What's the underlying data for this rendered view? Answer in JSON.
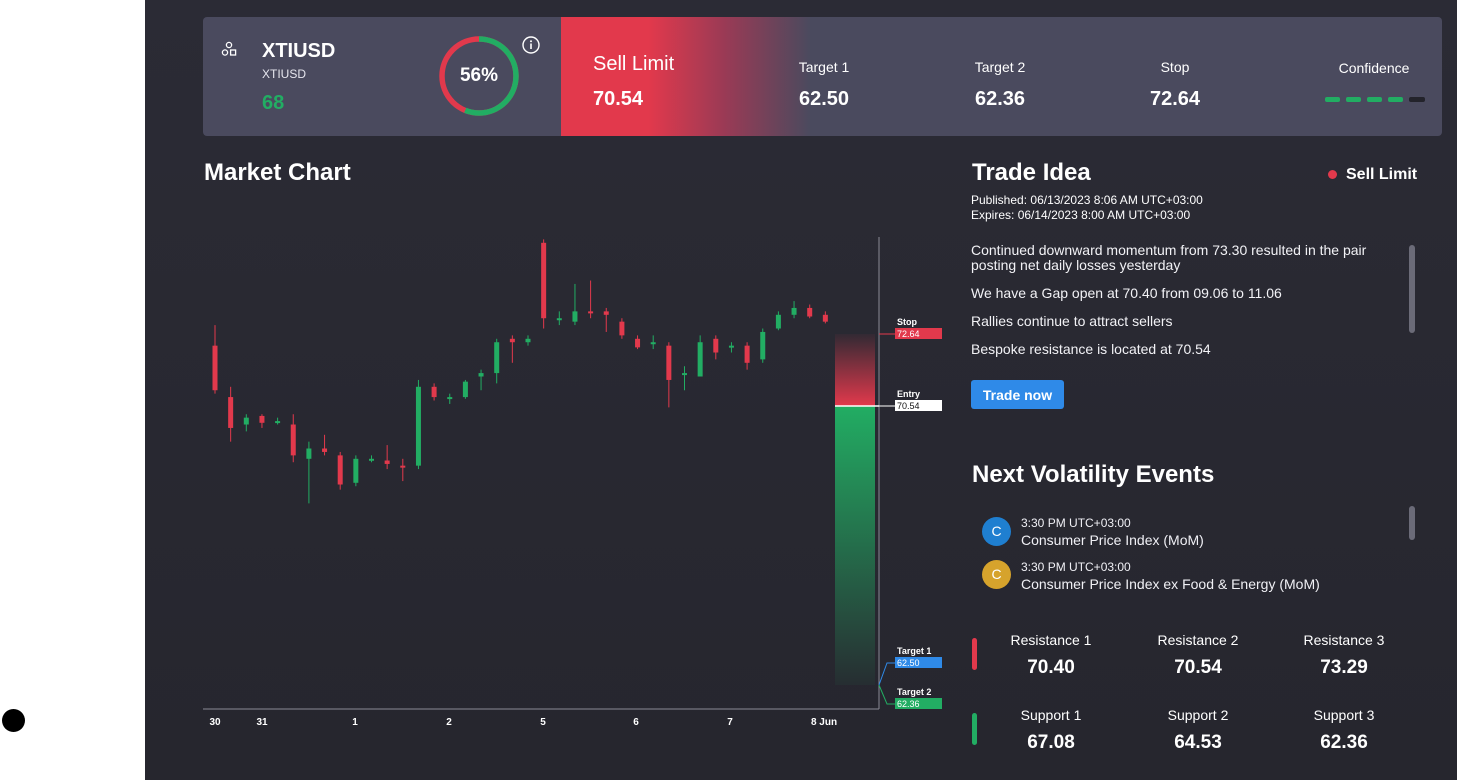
{
  "instrument": {
    "symbol": "XTIUSD",
    "sub_symbol": "XTIUSD",
    "score": "68",
    "percent": "56%",
    "percent_value": 56
  },
  "signal": {
    "label": "Sell Limit",
    "price": "70.54"
  },
  "metrics": [
    {
      "label": "Target 1",
      "value": "62.50"
    },
    {
      "label": "Target 2",
      "value": "62.36"
    },
    {
      "label": "Stop",
      "value": "72.64"
    }
  ],
  "confidence": {
    "label": "Confidence",
    "level": 4,
    "max": 5
  },
  "market_chart": {
    "title": "Market Chart"
  },
  "chart_data": {
    "type": "candlestick",
    "x_tick_labels": [
      "30",
      "31",
      "1",
      "2",
      "5",
      "6",
      "7",
      "8 Jun"
    ],
    "candles": [
      {
        "o": 72.3,
        "h": 72.9,
        "l": 70.9,
        "c": 71.0
      },
      {
        "o": 70.8,
        "h": 71.1,
        "l": 69.5,
        "c": 69.9
      },
      {
        "o": 70.0,
        "h": 70.3,
        "l": 69.8,
        "c": 70.2
      },
      {
        "o": 70.25,
        "h": 70.3,
        "l": 69.9,
        "c": 70.05
      },
      {
        "o": 70.1,
        "h": 70.2,
        "l": 70.0,
        "c": 70.1
      },
      {
        "o": 70.0,
        "h": 70.3,
        "l": 68.9,
        "c": 69.1
      },
      {
        "o": 69.0,
        "h": 69.5,
        "l": 67.7,
        "c": 69.3
      },
      {
        "o": 69.3,
        "h": 69.7,
        "l": 69.1,
        "c": 69.2
      },
      {
        "o": 69.1,
        "h": 69.2,
        "l": 68.1,
        "c": 68.25
      },
      {
        "o": 68.3,
        "h": 69.1,
        "l": 68.2,
        "c": 69.0
      },
      {
        "o": 69.0,
        "h": 69.1,
        "l": 68.9,
        "c": 69.0
      },
      {
        "o": 68.95,
        "h": 69.4,
        "l": 68.7,
        "c": 68.85
      },
      {
        "o": 68.8,
        "h": 69.0,
        "l": 68.35,
        "c": 68.75
      },
      {
        "o": 68.8,
        "h": 71.3,
        "l": 68.7,
        "c": 71.1
      },
      {
        "o": 71.1,
        "h": 71.2,
        "l": 70.7,
        "c": 70.8
      },
      {
        "o": 70.8,
        "h": 70.9,
        "l": 70.6,
        "c": 70.8
      },
      {
        "o": 70.8,
        "h": 71.3,
        "l": 70.75,
        "c": 71.25
      },
      {
        "o": 71.4,
        "h": 71.6,
        "l": 71.0,
        "c": 71.5
      },
      {
        "o": 71.5,
        "h": 72.5,
        "l": 71.2,
        "c": 72.4
      },
      {
        "o": 72.5,
        "h": 72.6,
        "l": 71.8,
        "c": 72.4
      },
      {
        "o": 72.4,
        "h": 72.6,
        "l": 72.3,
        "c": 72.5
      },
      {
        "o": 75.3,
        "h": 75.4,
        "l": 72.8,
        "c": 73.1
      },
      {
        "o": 73.1,
        "h": 73.3,
        "l": 72.9,
        "c": 73.1
      },
      {
        "o": 73.0,
        "h": 74.1,
        "l": 72.9,
        "c": 73.3
      },
      {
        "o": 73.3,
        "h": 74.2,
        "l": 73.1,
        "c": 73.25
      },
      {
        "o": 73.3,
        "h": 73.4,
        "l": 72.7,
        "c": 73.2
      },
      {
        "o": 73.0,
        "h": 73.1,
        "l": 72.5,
        "c": 72.6
      },
      {
        "o": 72.5,
        "h": 72.6,
        "l": 72.2,
        "c": 72.25
      },
      {
        "o": 72.4,
        "h": 72.6,
        "l": 72.2,
        "c": 72.4
      },
      {
        "o": 72.3,
        "h": 72.4,
        "l": 70.5,
        "c": 71.3
      },
      {
        "o": 71.5,
        "h": 71.7,
        "l": 71.0,
        "c": 71.5
      },
      {
        "o": 71.4,
        "h": 72.6,
        "l": 71.4,
        "c": 72.4
      },
      {
        "o": 72.5,
        "h": 72.6,
        "l": 71.9,
        "c": 72.1
      },
      {
        "o": 72.3,
        "h": 72.4,
        "l": 72.1,
        "c": 72.3
      },
      {
        "o": 72.3,
        "h": 72.4,
        "l": 71.6,
        "c": 71.8
      },
      {
        "o": 71.9,
        "h": 72.8,
        "l": 71.8,
        "c": 72.7
      },
      {
        "o": 72.8,
        "h": 73.3,
        "l": 72.75,
        "c": 73.2
      },
      {
        "o": 73.2,
        "h": 73.6,
        "l": 73.1,
        "c": 73.4
      },
      {
        "o": 73.4,
        "h": 73.5,
        "l": 73.1,
        "c": 73.15
      },
      {
        "o": 73.2,
        "h": 73.3,
        "l": 72.95,
        "c": 73.0
      }
    ],
    "levels": [
      {
        "name": "Stop",
        "value": "72.64",
        "color": "#e2394c"
      },
      {
        "name": "Entry",
        "value": "70.54",
        "color": "#ffffff"
      },
      {
        "name": "Target 1",
        "value": "62.50",
        "color": "#2f8ae8"
      },
      {
        "name": "Target 2",
        "value": "62.36",
        "color": "#22ad63"
      }
    ]
  },
  "trade_idea": {
    "title": "Trade Idea",
    "badge": "Sell Limit",
    "published_label": "Published:",
    "published": "06/13/2023 8:06 AM UTC+03:00",
    "expires_label": "Expires:",
    "expires": "06/14/2023 8:00 AM UTC+03:00",
    "paragraphs": [
      "Continued downward momentum from 73.30 resulted in the pair posting net daily losses yesterday",
      "We have a Gap open at 70.40 from 09.06 to 11.06",
      "Rallies continue to attract sellers",
      "Bespoke resistance is located at 70.54"
    ],
    "button": "Trade now"
  },
  "events": {
    "title": "Next Volatility Events",
    "items": [
      {
        "icon": "C",
        "color": "#1f7fd0",
        "time": "3:30 PM UTC+03:00",
        "name": "Consumer Price Index (MoM)"
      },
      {
        "icon": "C",
        "color": "#d6a32c",
        "time": "3:30 PM UTC+03:00",
        "name": "Consumer Price Index ex Food & Energy (MoM)"
      }
    ]
  },
  "levels": {
    "resistance": [
      {
        "label": "Resistance 1",
        "value": "70.40"
      },
      {
        "label": "Resistance 2",
        "value": "70.54"
      },
      {
        "label": "Resistance 3",
        "value": "73.29"
      }
    ],
    "support": [
      {
        "label": "Support 1",
        "value": "67.08"
      },
      {
        "label": "Support 2",
        "value": "64.53"
      },
      {
        "label": "Support 3",
        "value": "62.36"
      }
    ]
  },
  "colors": {
    "up": "#22ad63",
    "down": "#e2394c",
    "accent": "#2f8ae8"
  }
}
